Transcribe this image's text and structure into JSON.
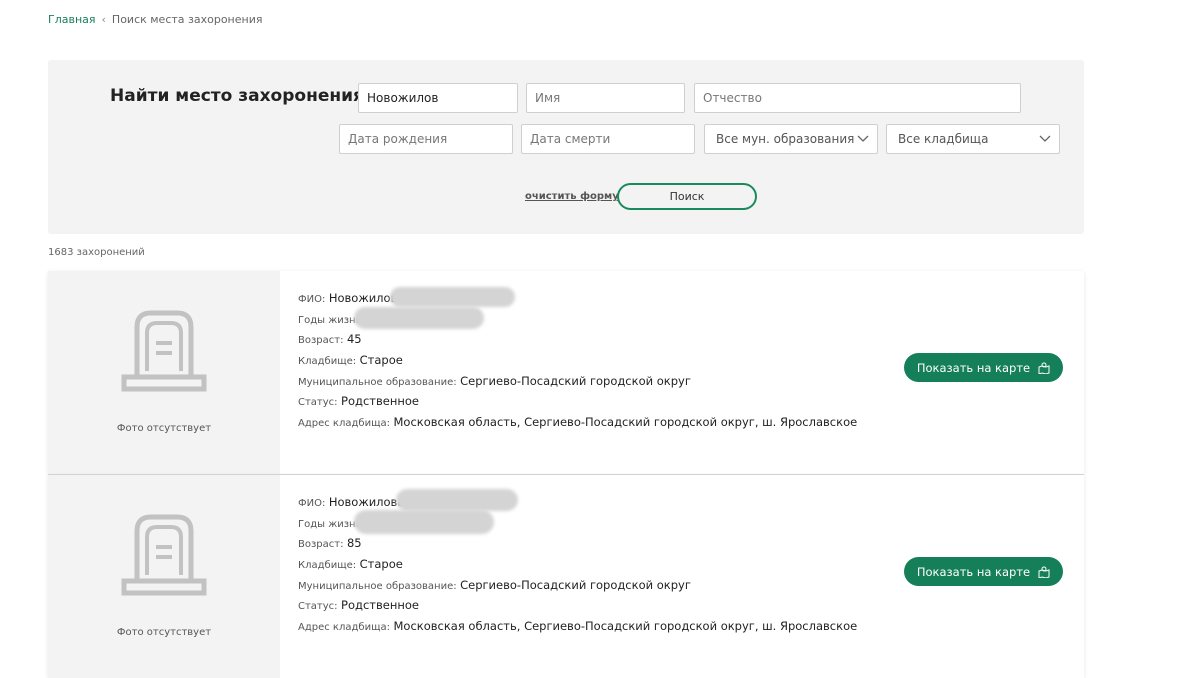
{
  "breadcrumb": {
    "home": "Главная",
    "current": "Поиск места захоронения"
  },
  "search": {
    "title": "Найти место захоронения",
    "last_name_value": "Новожилов",
    "first_name_placeholder": "Имя",
    "patronymic_placeholder": "Отчество",
    "birth_date_placeholder": "Дата рождения",
    "death_date_placeholder": "Дата смерти",
    "municipality_select": "Все мун. образования",
    "cemetery_select": "Все кладбища",
    "clear_label": "очистить форму",
    "search_label": "Поиск"
  },
  "results_count": "1683 захоронений",
  "labels": {
    "fio": "ФИО:",
    "years": "Годы жизни:",
    "age": "Возраст:",
    "cemetery": "Кладбище:",
    "municipality": "Муниципальное образование:",
    "status": "Статус:",
    "address": "Адрес кладбища:",
    "no_photo": "Фото отсутствует",
    "show_on_map": "Показать на карте"
  },
  "results": [
    {
      "fio": "Новожилов",
      "years": "",
      "age": "45",
      "cemetery": "Старое",
      "municipality": "Сергиево-Посадский городской округ",
      "status": "Родственное",
      "address": "Московская область, Сергиево-Посадский городской округ, ш. Ярославское"
    },
    {
      "fio": "Новожилова",
      "years": "",
      "age": "85",
      "cemetery": "Старое",
      "municipality": "Сергиево-Посадский городской округ",
      "status": "Родственное",
      "address": "Московская область, Сергиево-Посадский городской округ, ш. Ярославское"
    }
  ],
  "colors": {
    "accent": "#157f5a",
    "panel": "#f3f3f3",
    "redaction": "#d4d4d4"
  },
  "icons": {
    "tombstone": "tombstone-icon",
    "map": "map-icon",
    "chevron": "chevron-down-icon",
    "breadcrumb_separator": "chevron-left-icon"
  }
}
